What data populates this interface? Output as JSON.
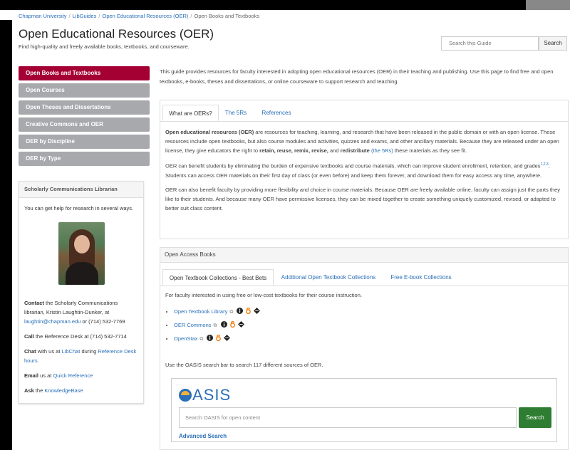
{
  "breadcrumb": [
    "Chapman University",
    "LibGuides",
    "Open Educational Resources (OER)",
    "Open Books and Textbooks"
  ],
  "header": {
    "title": "Open Educational Resources (OER)",
    "subtitle": "Find high-quality and freely available books, textbooks, and courseware.",
    "search_placeholder": "Search this Guide",
    "search_button": "Search"
  },
  "nav": {
    "items": [
      {
        "label": "Open Books and Textbooks"
      },
      {
        "label": "Open Courses"
      },
      {
        "label": "Open Theses and Dissertations"
      },
      {
        "label": "Creative Commons and OER"
      },
      {
        "label": "OER by Discipline"
      },
      {
        "label": "OER by Type"
      }
    ]
  },
  "librarian": {
    "heading": "Scholarly Communications Librarian",
    "help": "You can get help for research in several ways.",
    "contact_lead": "Contact",
    "contact_text": " the Scholarly Communications librarian, Kristin Laughtin-Dunker, at ",
    "contact_email": "laughtin@chapman.edu",
    "contact_phone": " or (714) 532-7769",
    "call_lead": "Call",
    "call_text": " the Reference Desk at (714) 532-7714",
    "chat_lead": "Chat",
    "chat_text1": " with us at ",
    "chat_link1": "LibChat",
    "chat_text2": " during ",
    "chat_link2": "Reference Desk hours",
    "email_lead": "Email",
    "email_text": " us at ",
    "email_link": "Quick Reference",
    "ask_lead": "Ask",
    "ask_text": " the ",
    "ask_link": "KnowledgeBase"
  },
  "intro": "This guide provides resources for faculty interested in adopting open educational resources (OER) in their teaching and publishing.  Use this page to find free and open textbooks, e-books, theses and dissertations, or online courseware to support research and teaching.",
  "box1": {
    "tabs": [
      "What are OERs?",
      "The 5Rs",
      "References"
    ],
    "p1_bold": "Open educational resources (OER)",
    "p1_text": " are resources for teaching, learning, and research that have been released in the public domain or with an open license. These resources include open textbooks, but also course modules and activities, quizzes and exams, and other ancillary materials. Because they are released under an open license, they give educators the right to ",
    "p1_bold2": "retain, reuse, remix, revise,",
    "p1_and": " and ",
    "p1_bold3": "redistribute",
    "p1_link": "(the 5Rs)",
    "p1_end": " these materials as they see fit.",
    "p2_a": "OER can benefit students by eliminating the burden of expensive textbooks and course materials, which can improve student enrollment, retention, and grades",
    "p2_sup": "1,2,3",
    "p2_b": ". Students can access OER materials on their first day of class (or even before) and keep them forever, and download them for easy access any time, anywhere.",
    "p3": "OER can also benefit faculty by providing more flexibility and choice in course materials. Because OER are freely available online, faculty can assign just the parts they like to their students. And because many OER have permissive licenses, they can be mixed together to create something uniquely customized, revised, or adapted to better suit class content."
  },
  "box2": {
    "heading": "Open Access Books",
    "tabs": [
      "Open Textbook Collections - Best Bets",
      "Additional Open Textbook Collections",
      "Free E-book Collections"
    ],
    "lead": "For faculty interested in using free or low-cost textbooks for their course instruction.",
    "links": [
      "Open Textbook Library",
      "OER Commons",
      "OpenStax"
    ],
    "oasis_text": "Use the OASIS search bar to search 117 different sources of OER.",
    "oasis_logo": "ASIS",
    "oasis_placeholder": "Search OASIS for open content",
    "oasis_button": "Search",
    "oasis_advanced": "Advanced Search"
  },
  "colors": {
    "accent": "#a50034",
    "nav_inactive": "#a7a9ac",
    "link": "#2a6fb8",
    "search_green": "#2e7d32"
  }
}
